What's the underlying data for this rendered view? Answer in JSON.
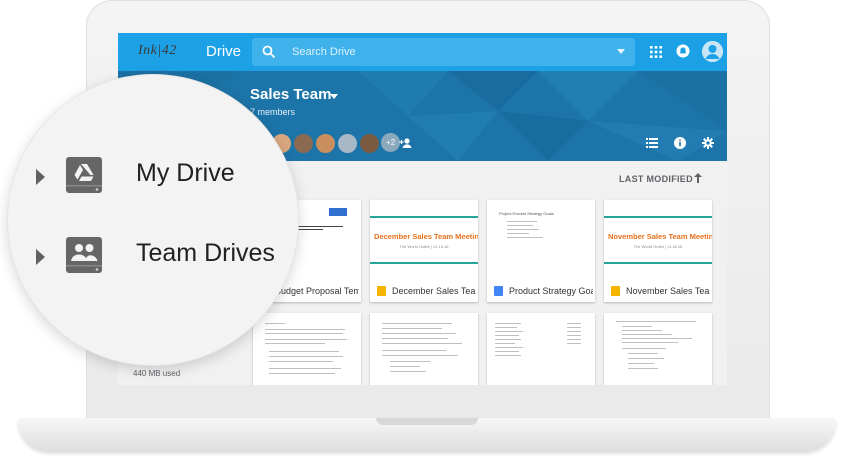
{
  "app": {
    "logo": "Ink|42",
    "name": "Drive"
  },
  "search": {
    "placeholder": "Search Drive"
  },
  "team": {
    "name": "Sales Team",
    "members": "7 members",
    "more_members": "+2"
  },
  "sort": {
    "label": "LAST MODIFIED"
  },
  "sidebar": {
    "items": [
      {
        "label": "My Drive"
      },
      {
        "label": "Team Drives"
      }
    ]
  },
  "storage": {
    "used": "440 MB used"
  },
  "files": [
    {
      "name": "Budget Proposal Tem...",
      "type": "doc"
    },
    {
      "name": "December Sales Tea...",
      "type": "slides",
      "slide_title": "December Sales Team Meeting",
      "slide_sub": "The World Outlet | 12.15.16"
    },
    {
      "name": "Product Strategy Goa...",
      "type": "doc",
      "doc_title": "Project Everest Strategy Goals"
    },
    {
      "name": "November Sales Tea...",
      "type": "slides",
      "slide_title": "November Sales Team Meeting",
      "slide_sub": "The World Outlet | 11.18.16"
    }
  ],
  "colors": {
    "topbar": "#1da1e6",
    "banner": "#1d74a8",
    "slides": "#f4b400",
    "docs": "#4285f4",
    "accent_orange": "#e8711c",
    "accent_teal": "#26a69a"
  }
}
